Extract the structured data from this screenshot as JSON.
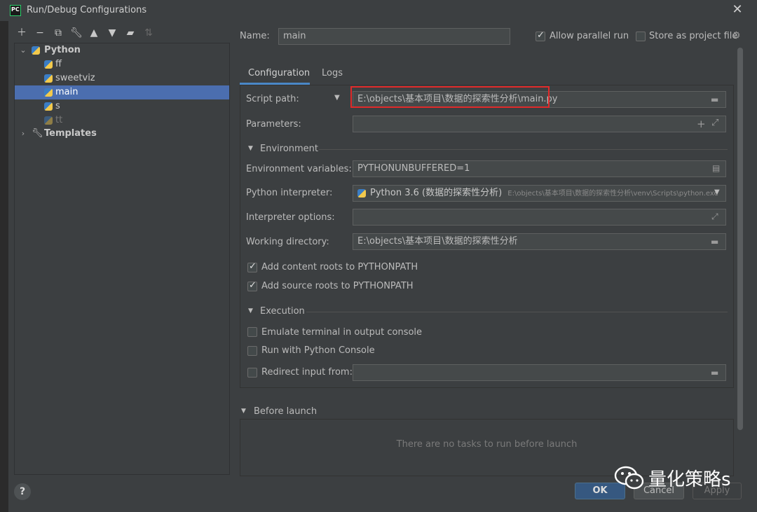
{
  "window": {
    "title": "Run/Debug Configurations"
  },
  "toolbar": {
    "icons": [
      "plus-icon",
      "minus-icon",
      "copy-icon",
      "wrench-icon",
      "arrow-up-icon",
      "arrow-down-icon",
      "folder-icon",
      "sort-icon"
    ]
  },
  "tree": {
    "python_group": "Python",
    "items": [
      "ff",
      "sweetviz",
      "main",
      "s",
      "tt"
    ],
    "selected": "main",
    "templates": "Templates"
  },
  "name_row": {
    "label": "Name:",
    "value": "main",
    "allow_parallel": "Allow parallel run",
    "store_project": "Store as project file"
  },
  "tabs": [
    "Configuration",
    "Logs"
  ],
  "config": {
    "script_path_label": "Script path:",
    "script_path_value": "E:\\objects\\基本项目\\数据的探索性分析\\main.py",
    "parameters_label": "Parameters:",
    "environment_section": "Environment",
    "env_vars_label": "Environment variables:",
    "env_vars_value": "PYTHONUNBUFFERED=1",
    "interpreter_label": "Python interpreter:",
    "interpreter_name": "Python 3.6 (数据的探索性分析)",
    "interpreter_path": "E:\\objects\\基本项目\\数据的探索性分析\\venv\\Scripts\\python.exe",
    "interp_options_label": "Interpreter options:",
    "workdir_label": "Working directory:",
    "workdir_value": "E:\\objects\\基本项目\\数据的探索性分析",
    "content_roots": "Add content roots to PYTHONPATH",
    "source_roots": "Add source roots to PYTHONPATH",
    "execution_section": "Execution",
    "emulate_terminal": "Emulate terminal in output console",
    "python_console": "Run with Python Console",
    "redirect_input": "Redirect input from:"
  },
  "before_launch": {
    "title": "Before launch",
    "empty": "There are no tasks to run before launch"
  },
  "buttons": {
    "ok": "OK",
    "cancel": "Cancel",
    "apply": "Apply",
    "help": "?"
  },
  "watermark": "量化策略s",
  "colors": {
    "background": "#3c3f41",
    "selection": "#4b6eaf",
    "highlight_box": "#e02a2a",
    "ok_button": "#365880"
  }
}
